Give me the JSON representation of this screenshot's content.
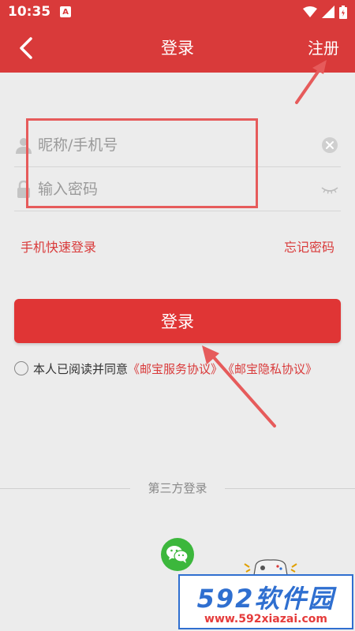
{
  "status_bar": {
    "time": "10:35",
    "notification_badge": "A"
  },
  "header": {
    "title": "登录",
    "register_label": "注册"
  },
  "form": {
    "username_placeholder": "昵称/手机号",
    "password_placeholder": "输入密码"
  },
  "links": {
    "phone_quick_login": "手机快速登录",
    "forgot_password": "忘记密码"
  },
  "login_button": "登录",
  "agreement": {
    "prefix": "本人已阅读并同意",
    "service_agreement": "《邮宝服务协议》",
    "privacy_agreement": "《邮宝隐私协议》"
  },
  "third_party": {
    "label": "第三方登录"
  },
  "watermark": {
    "brand": "592软件园",
    "url": "www.592xiazai.com"
  },
  "colors": {
    "brand_red": "#d93a3a",
    "button_red": "#e03535",
    "wechat_green": "#3cb73c",
    "watermark_blue": "#2f6fd0"
  }
}
